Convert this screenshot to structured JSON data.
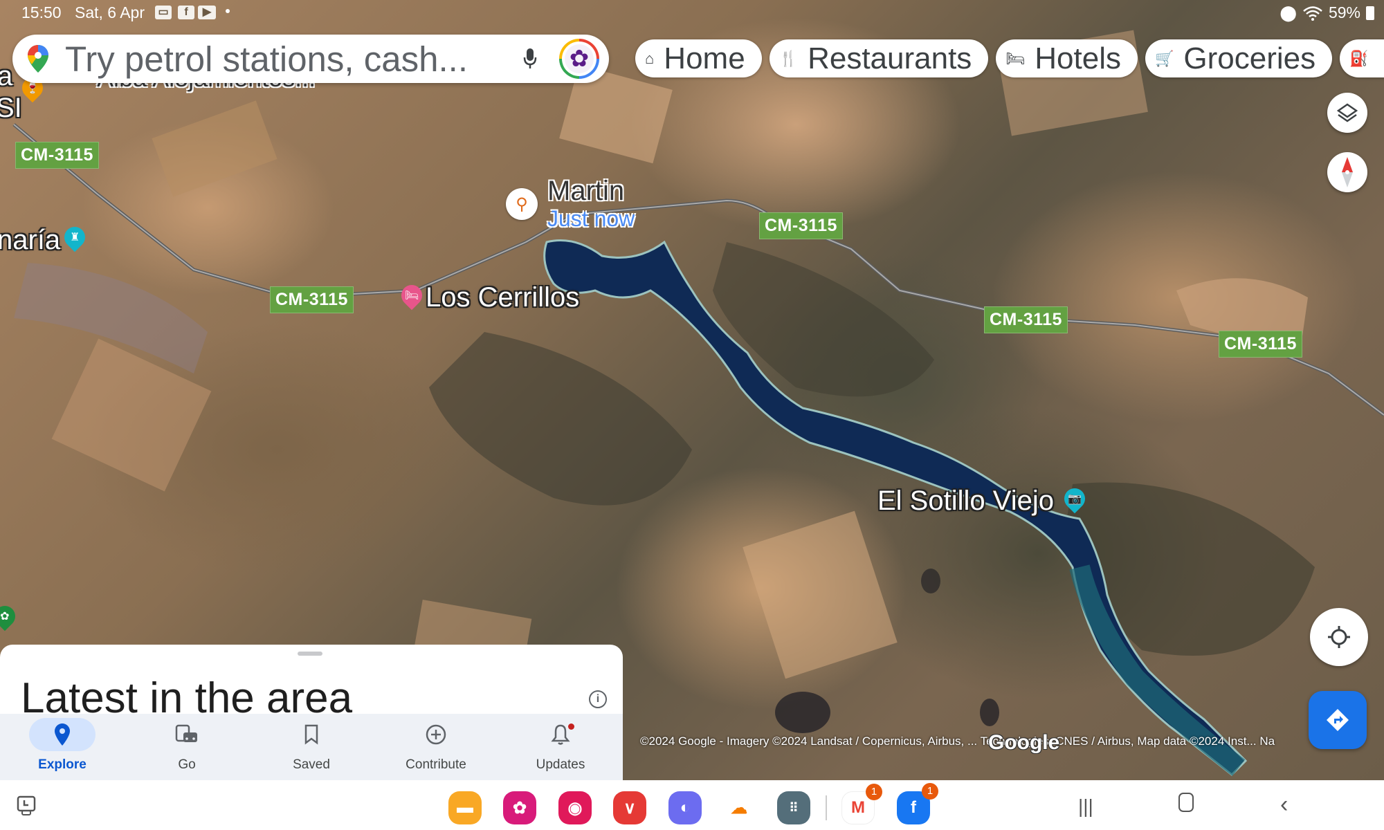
{
  "status_bar": {
    "time": "15:50",
    "date": "Sat, 6 Apr",
    "notification_icons": [
      "calendar-icon",
      "facebook-icon",
      "youtube-icon",
      "dot-icon"
    ],
    "battery": "59%",
    "right_icons": [
      "location-icon",
      "wifi-icon",
      "battery-charging-icon"
    ]
  },
  "search": {
    "placeholder": "Try petrol stations, cash...",
    "icons": [
      "google-maps-logo-icon",
      "mic-icon",
      "account-avatar-icon"
    ]
  },
  "chips": [
    {
      "label": "Home",
      "icon": "home-icon",
      "glyph": "⌂"
    },
    {
      "label": "Restaurants",
      "icon": "cutlery-icon",
      "glyph": "🍴"
    },
    {
      "label": "Hotels",
      "icon": "bed-icon",
      "glyph": "🛏"
    },
    {
      "label": "Groceries",
      "icon": "cart-icon",
      "glyph": "🛒"
    },
    {
      "label": "",
      "icon": "fuel-icon",
      "glyph": "⛽"
    }
  ],
  "map": {
    "labels": {
      "alba": "Alba Alojamientos...",
      "left_partial_1": "a",
      "left_partial_2": "SI",
      "maria": "naría",
      "martin": "Martin",
      "martin_time": "Just now",
      "los_cerrillos": "Los Cerrillos",
      "el_sotillo": "El Sotillo Viejo"
    },
    "road_shields": [
      "CM-3115",
      "CM-3115",
      "CM-3115",
      "CM-3115",
      "CM-3115"
    ],
    "attribution": "©2024 Google - Imagery ©2024 Landsat / Copernicus, Airbus, ... Technologies, CNES / Airbus, Map data ©2024 Inst... Na",
    "google_logo": "Google",
    "colors": {
      "road_shield": "#63a142",
      "water": "#0f2a55",
      "directions": "#1a73e8"
    }
  },
  "sheet": {
    "title": "Latest in the area",
    "info_glyph": "i"
  },
  "bottom_nav": [
    {
      "label": "Explore",
      "icon": "explore-pin-icon",
      "active": true
    },
    {
      "label": "Go",
      "icon": "commute-icon",
      "active": false
    },
    {
      "label": "Saved",
      "icon": "bookmark-icon",
      "active": false
    },
    {
      "label": "Contribute",
      "icon": "add-circle-icon",
      "active": false
    },
    {
      "label": "Updates",
      "icon": "bell-icon",
      "active": false,
      "dot": true
    }
  ],
  "taskbar": {
    "apps": [
      {
        "name": "my-files",
        "color": "#f9a825"
      },
      {
        "name": "gallery",
        "color": "#d81b7a"
      },
      {
        "name": "camera",
        "color": "#e0195a"
      },
      {
        "name": "email",
        "color": "#e53935"
      },
      {
        "name": "internet",
        "color": "#6c6cf0"
      },
      {
        "name": "cloud-chrome",
        "color": "#ffffff"
      },
      {
        "name": "app-drawer",
        "color": "#546e7a"
      },
      {
        "name": "gmail",
        "color": "#ffffff",
        "badge": "1"
      },
      {
        "name": "facebook",
        "color": "#1877f2",
        "badge": "1"
      }
    ]
  }
}
